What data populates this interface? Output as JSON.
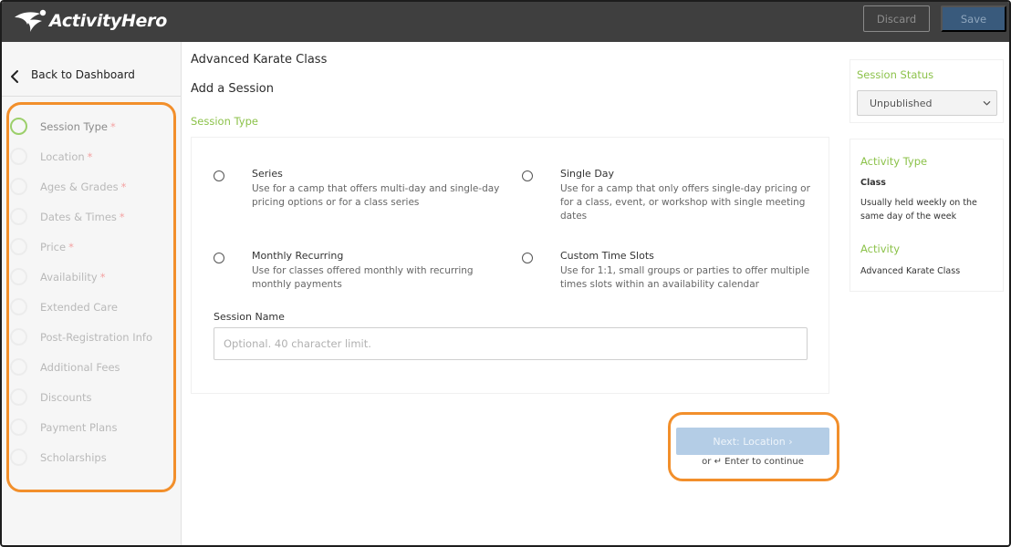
{
  "app": {
    "logo_text": "ActivityHero"
  },
  "header": {
    "discard_label": "Discard",
    "save_label": "Save"
  },
  "sidebar": {
    "back_label": "Back to Dashboard",
    "steps": [
      {
        "label": "Session Type",
        "required": "*"
      },
      {
        "label": "Location",
        "required": "*"
      },
      {
        "label": "Ages & Grades",
        "required": "*"
      },
      {
        "label": "Dates & Times",
        "required": "*"
      },
      {
        "label": "Price",
        "required": "*"
      },
      {
        "label": "Availability",
        "required": "*"
      },
      {
        "label": "Extended Care",
        "required": ""
      },
      {
        "label": "Post-Registration Info",
        "required": ""
      },
      {
        "label": "Additional Fees",
        "required": ""
      },
      {
        "label": "Discounts",
        "required": ""
      },
      {
        "label": "Payment Plans",
        "required": ""
      },
      {
        "label": "Scholarships",
        "required": ""
      }
    ]
  },
  "main": {
    "title": "Advanced Karate Class",
    "subtitle": "Add a Session",
    "section_label": "Session Type",
    "options": [
      {
        "title": "Series",
        "desc": "Use for a camp that offers multi-day and single-day pricing options or for a class series"
      },
      {
        "title": "Single Day",
        "desc": "Use for a camp that only offers single-day pricing or for a class, event, or workshop with single meeting dates"
      },
      {
        "title": "Monthly Recurring",
        "desc": "Use for classes offered monthly with recurring monthly payments"
      },
      {
        "title": "Custom Time Slots",
        "desc": "Use for 1:1, small groups or parties to offer multiple times slots within an availability calendar"
      }
    ],
    "session_name_label": "Session Name",
    "session_name_placeholder": "Optional. 40 character limit.",
    "next_label": "Next: Location ›",
    "enter_hint": "or ↵ Enter to continue"
  },
  "right": {
    "status_label": "Session Status",
    "status_value": "Unpublished",
    "activity_type_heading": "Activity Type",
    "activity_type_value": "Class",
    "activity_type_desc": "Usually held weekly on the same day of the week",
    "activity_heading": "Activity",
    "activity_value": "Advanced Karate Class"
  },
  "colors": {
    "accent_green": "#8cc24a",
    "highlight_orange": "#f28f2b",
    "topbar": "#3f3f3f",
    "save_blue": "#395a7c",
    "next_blue": "#b4cde6"
  }
}
